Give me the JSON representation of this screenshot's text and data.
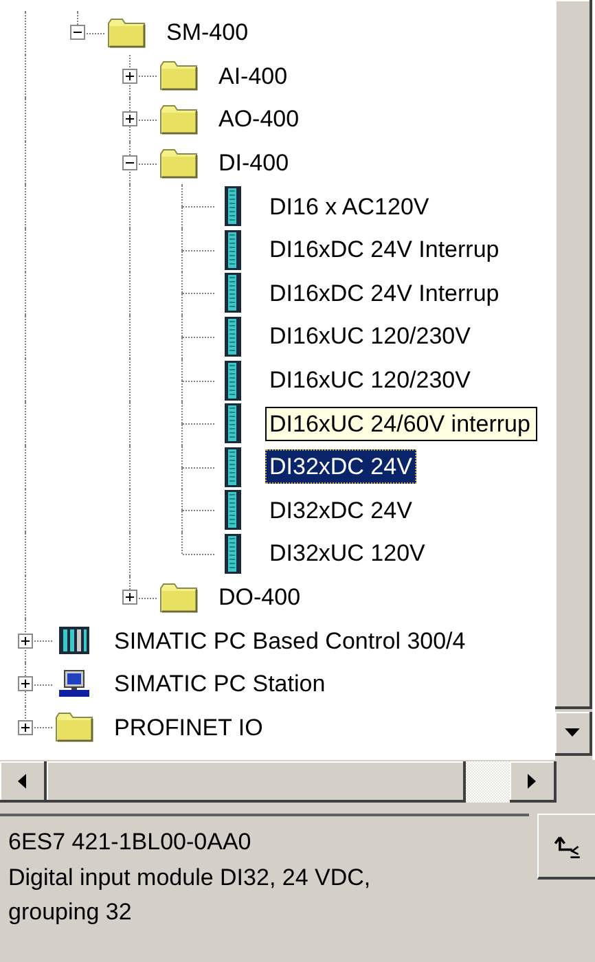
{
  "tree": {
    "continued": [
      {
        "label": "SM-400",
        "kind": "folder",
        "expanded": true,
        "selected": false,
        "children": [
          {
            "label": "AI-400",
            "kind": "folder",
            "expanded": false,
            "selected": false
          },
          {
            "label": "AO-400",
            "kind": "folder",
            "expanded": false,
            "selected": false
          },
          {
            "label": "DI-400",
            "kind": "folder",
            "expanded": true,
            "selected": false,
            "children": [
              {
                "label": "DI16 x AC120V",
                "kind": "module",
                "selected": false,
                "tooltip": false
              },
              {
                "label": "DI16xDC 24V Interrup",
                "kind": "module",
                "selected": false,
                "tooltip": false
              },
              {
                "label": "DI16xDC 24V Interrup",
                "kind": "module",
                "selected": false,
                "tooltip": false
              },
              {
                "label": "DI16xUC 120/230V",
                "kind": "module",
                "selected": false,
                "tooltip": false
              },
              {
                "label": "DI16xUC 120/230V",
                "kind": "module",
                "selected": false,
                "tooltip": false
              },
              {
                "label": "DI16xUC 24/60V interrup",
                "kind": "module",
                "selected": false,
                "tooltip": true
              },
              {
                "label": "DI32xDC 24V",
                "kind": "module",
                "selected": true,
                "tooltip": false
              },
              {
                "label": "DI32xDC 24V",
                "kind": "module",
                "selected": false,
                "tooltip": false
              },
              {
                "label": "DI32xUC 120V",
                "kind": "module",
                "selected": false,
                "tooltip": false
              }
            ]
          },
          {
            "label": "DO-400",
            "kind": "folder",
            "expanded": false,
            "selected": false
          }
        ]
      }
    ],
    "items": [
      {
        "label": "SIMATIC PC Based Control 300/4",
        "kind": "pc-control",
        "expanded": false,
        "selected": false
      },
      {
        "label": "SIMATIC PC Station",
        "kind": "pc-station",
        "expanded": false,
        "selected": false
      },
      {
        "label": "PROFINET IO",
        "kind": "folder",
        "expanded": false,
        "selected": false
      }
    ]
  },
  "info": {
    "order_number": "6ES7 421-1BL00-0AA0",
    "description": "Digital input module DI32, 24 VDC, grouping 32"
  }
}
